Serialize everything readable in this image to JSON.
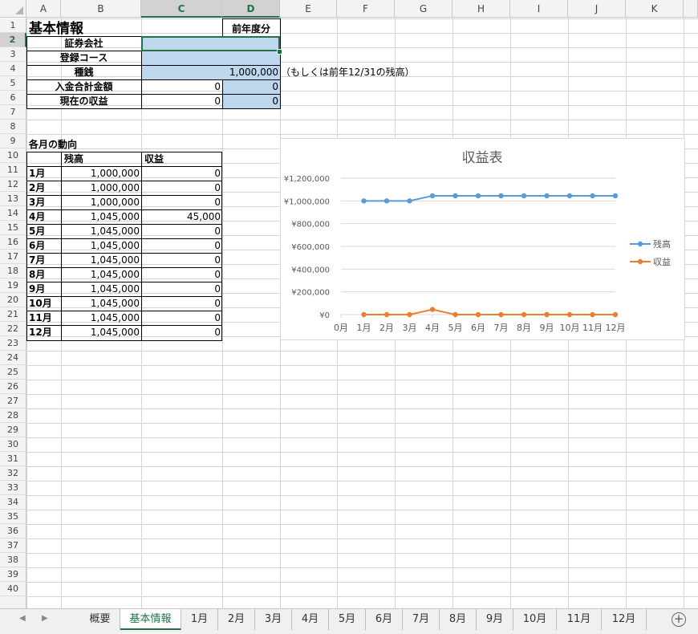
{
  "columns": [
    "A",
    "B",
    "C",
    "D",
    "E",
    "F",
    "G",
    "H",
    "I",
    "J",
    "K"
  ],
  "selected_columns": [
    "C",
    "D"
  ],
  "rows": [
    "1",
    "2",
    "3",
    "4",
    "5",
    "6",
    "7",
    "8",
    "9",
    "10",
    "11",
    "12",
    "13",
    "14",
    "15",
    "16",
    "17",
    "18",
    "19",
    "20",
    "21",
    "22",
    "23",
    "24",
    "25",
    "26",
    "27",
    "28",
    "29",
    "30",
    "31",
    "32",
    "33",
    "34",
    "35",
    "36",
    "37",
    "38",
    "39",
    "40"
  ],
  "selected_row": "2",
  "basic_info": {
    "title": "基本情報",
    "prev_year_header": "前年度分",
    "labels": [
      "証券会社",
      "登録コース",
      "種銭",
      "入金合計金額",
      "現在の収益"
    ],
    "seed_money": "1,000,000",
    "seed_note": "（もしくは前年12/31の残高）",
    "deposit_total": "0",
    "deposit_prev": "0",
    "profit_now": "0",
    "profit_prev": "0"
  },
  "monthly": {
    "title": "各月の動向",
    "headers": [
      "",
      "残高",
      "収益"
    ],
    "rows": [
      {
        "month": "1月",
        "balance": "1,000,000",
        "profit": "0"
      },
      {
        "month": "2月",
        "balance": "1,000,000",
        "profit": "0"
      },
      {
        "month": "3月",
        "balance": "1,000,000",
        "profit": "0"
      },
      {
        "month": "4月",
        "balance": "1,045,000",
        "profit": "45,000"
      },
      {
        "month": "5月",
        "balance": "1,045,000",
        "profit": "0"
      },
      {
        "month": "6月",
        "balance": "1,045,000",
        "profit": "0"
      },
      {
        "month": "7月",
        "balance": "1,045,000",
        "profit": "0"
      },
      {
        "month": "8月",
        "balance": "1,045,000",
        "profit": "0"
      },
      {
        "month": "9月",
        "balance": "1,045,000",
        "profit": "0"
      },
      {
        "month": "10月",
        "balance": "1,045,000",
        "profit": "0"
      },
      {
        "month": "11月",
        "balance": "1,045,000",
        "profit": "0"
      },
      {
        "month": "12月",
        "balance": "1,045,000",
        "profit": "0"
      }
    ]
  },
  "chart_data": {
    "type": "line",
    "title": "収益表",
    "categories": [
      "0月",
      "1月",
      "2月",
      "3月",
      "4月",
      "5月",
      "6月",
      "7月",
      "8月",
      "9月",
      "10月",
      "11月",
      "12月"
    ],
    "ylim": [
      0,
      1200000
    ],
    "yticks": [
      "¥0",
      "¥200,000",
      "¥400,000",
      "¥600,000",
      "¥800,000",
      "¥1,000,000",
      "¥1,200,000"
    ],
    "grid": true,
    "legend": "right",
    "series": [
      {
        "name": "残高",
        "color": "#5b9bd5",
        "values": [
          null,
          1000000,
          1000000,
          1000000,
          1045000,
          1045000,
          1045000,
          1045000,
          1045000,
          1045000,
          1045000,
          1045000,
          1045000
        ]
      },
      {
        "name": "収益",
        "color": "#ed7d31",
        "values": [
          null,
          0,
          0,
          0,
          45000,
          0,
          0,
          0,
          0,
          0,
          0,
          0,
          0
        ]
      }
    ]
  },
  "sheet_tabs": [
    "概要",
    "基本情報",
    "1月",
    "2月",
    "3月",
    "4月",
    "5月",
    "6月",
    "7月",
    "8月",
    "9月",
    "10月",
    "11月",
    "12月"
  ],
  "active_tab": "基本情報",
  "add_sheet_label": "+",
  "nav": {
    "prev": "◀",
    "next": "▶"
  },
  "colors": {
    "accent": "#217346",
    "input_fill": "#bdd7ee"
  }
}
